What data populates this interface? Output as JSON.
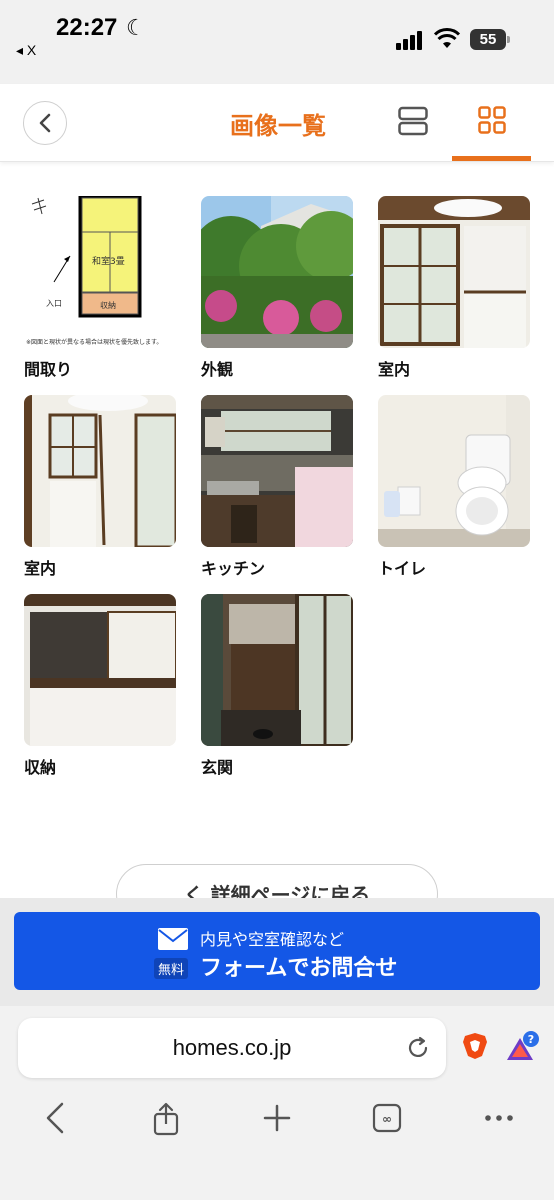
{
  "status": {
    "time": "22:27",
    "back_app": "◂ X",
    "battery": "55"
  },
  "header": {
    "title": "画像一覧"
  },
  "photos": [
    {
      "label": "間取り"
    },
    {
      "label": "外観"
    },
    {
      "label": "室内"
    },
    {
      "label": "室内"
    },
    {
      "label": "キッチン"
    },
    {
      "label": "トイレ"
    },
    {
      "label": "収納"
    },
    {
      "label": "玄関"
    }
  ],
  "floorplan": {
    "room": "和室3畳",
    "storage": "収納",
    "entrance": "入口",
    "note": "※図面と現状が異なる場合は現状を優先致します。"
  },
  "back_detail": {
    "label": "く 詳細ページに戻る"
  },
  "contact": {
    "free": "無料",
    "sub": "内見や空室確認など",
    "main": "フォームでお問合せ"
  },
  "browser": {
    "url": "homes.co.jp"
  },
  "colors": {
    "accent": "#e8701c",
    "contact_blue": "#1457e6"
  }
}
